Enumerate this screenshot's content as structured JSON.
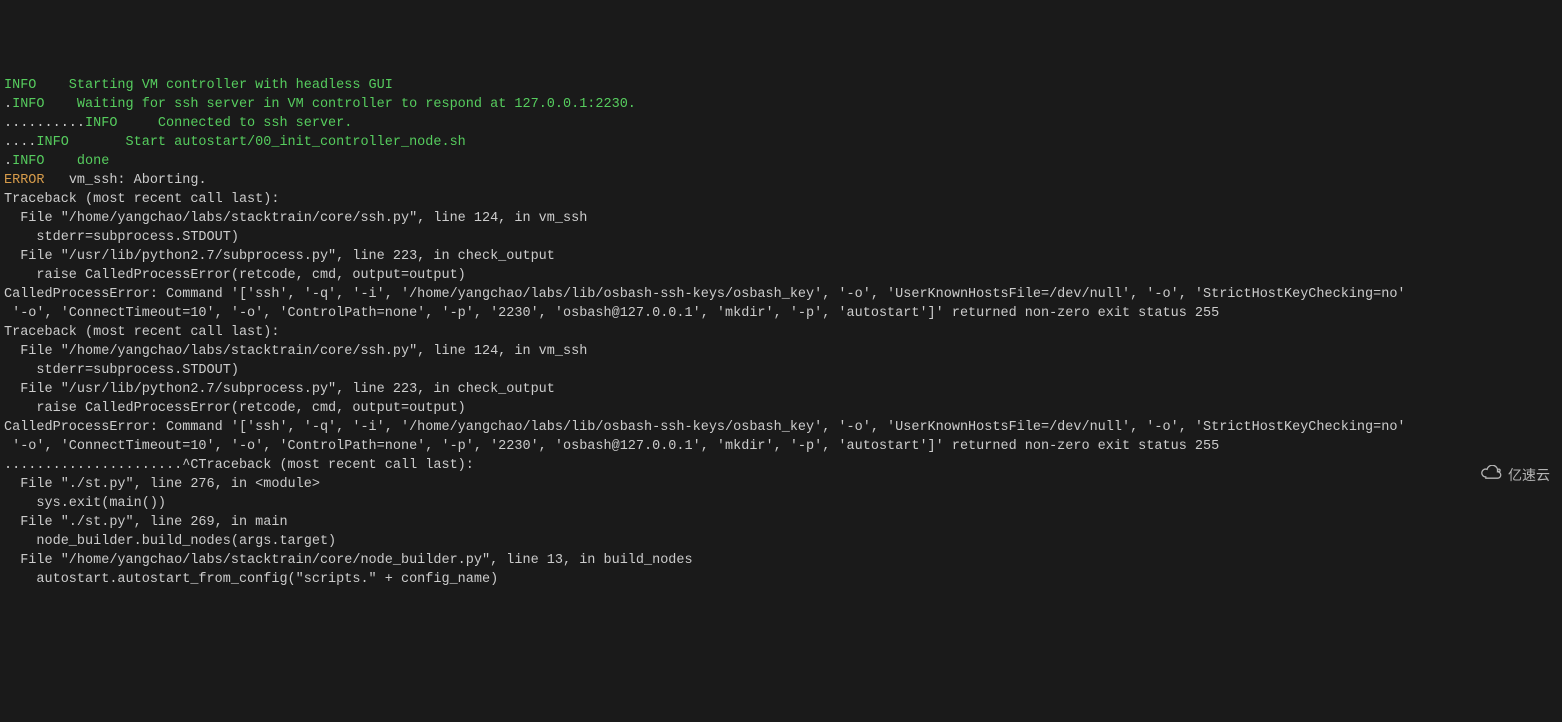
{
  "lines": [
    {
      "segments": [
        {
          "cls": "green",
          "text": "INFO"
        },
        {
          "cls": "green",
          "text": "    Starting VM controller with headless GUI"
        }
      ]
    },
    {
      "segments": [
        {
          "cls": "gray",
          "text": "."
        },
        {
          "cls": "green",
          "text": "INFO"
        },
        {
          "cls": "green",
          "text": "    Waiting for ssh server in VM controller to respond at 127.0.0.1:2230."
        }
      ]
    },
    {
      "segments": [
        {
          "cls": "gray",
          "text": ".........."
        },
        {
          "cls": "green",
          "text": "INFO"
        },
        {
          "cls": "green",
          "text": "     Connected to ssh server."
        }
      ]
    },
    {
      "segments": [
        {
          "cls": "gray",
          "text": "...."
        },
        {
          "cls": "green",
          "text": "INFO"
        },
        {
          "cls": "green",
          "text": "       Start autostart/00_init_controller_node.sh"
        }
      ]
    },
    {
      "segments": [
        {
          "cls": "gray",
          "text": "."
        },
        {
          "cls": "green",
          "text": "INFO"
        },
        {
          "cls": "green",
          "text": "    done"
        }
      ]
    },
    {
      "segments": [
        {
          "cls": "orange",
          "text": "ERROR"
        },
        {
          "cls": "gray",
          "text": "   vm_ssh: Aborting."
        }
      ]
    },
    {
      "segments": [
        {
          "cls": "gray",
          "text": "Traceback (most recent call last):"
        }
      ]
    },
    {
      "segments": [
        {
          "cls": "gray",
          "text": "  File \"/home/yangchao/labs/stacktrain/core/ssh.py\", line 124, in vm_ssh"
        }
      ]
    },
    {
      "segments": [
        {
          "cls": "gray",
          "text": "    stderr=subprocess.STDOUT)"
        }
      ]
    },
    {
      "segments": [
        {
          "cls": "gray",
          "text": "  File \"/usr/lib/python2.7/subprocess.py\", line 223, in check_output"
        }
      ]
    },
    {
      "segments": [
        {
          "cls": "gray",
          "text": "    raise CalledProcessError(retcode, cmd, output=output)"
        }
      ]
    },
    {
      "segments": [
        {
          "cls": "gray",
          "text": "CalledProcessError: Command '['ssh', '-q', '-i', '/home/yangchao/labs/lib/osbash-ssh-keys/osbash_key', '-o', 'UserKnownHostsFile=/dev/null', '-o', 'StrictHostKeyChecking=no'"
        }
      ]
    },
    {
      "segments": [
        {
          "cls": "gray",
          "text": " '-o', 'ConnectTimeout=10', '-o', 'ControlPath=none', '-p', '2230', 'osbash@127.0.0.1', 'mkdir', '-p', 'autostart']' returned non-zero exit status 255"
        }
      ]
    },
    {
      "segments": [
        {
          "cls": "gray",
          "text": "Traceback (most recent call last):"
        }
      ]
    },
    {
      "segments": [
        {
          "cls": "gray",
          "text": "  File \"/home/yangchao/labs/stacktrain/core/ssh.py\", line 124, in vm_ssh"
        }
      ]
    },
    {
      "segments": [
        {
          "cls": "gray",
          "text": "    stderr=subprocess.STDOUT)"
        }
      ]
    },
    {
      "segments": [
        {
          "cls": "gray",
          "text": "  File \"/usr/lib/python2.7/subprocess.py\", line 223, in check_output"
        }
      ]
    },
    {
      "segments": [
        {
          "cls": "gray",
          "text": "    raise CalledProcessError(retcode, cmd, output=output)"
        }
      ]
    },
    {
      "segments": [
        {
          "cls": "gray",
          "text": "CalledProcessError: Command '['ssh', '-q', '-i', '/home/yangchao/labs/lib/osbash-ssh-keys/osbash_key', '-o', 'UserKnownHostsFile=/dev/null', '-o', 'StrictHostKeyChecking=no'"
        }
      ]
    },
    {
      "segments": [
        {
          "cls": "gray",
          "text": " '-o', 'ConnectTimeout=10', '-o', 'ControlPath=none', '-p', '2230', 'osbash@127.0.0.1', 'mkdir', '-p', 'autostart']' returned non-zero exit status 255"
        }
      ]
    },
    {
      "segments": [
        {
          "cls": "gray",
          "text": "......................^CTraceback (most recent call last):"
        }
      ]
    },
    {
      "segments": [
        {
          "cls": "gray",
          "text": "  File \"./st.py\", line 276, in <module>"
        }
      ]
    },
    {
      "segments": [
        {
          "cls": "gray",
          "text": "    sys.exit(main())"
        }
      ]
    },
    {
      "segments": [
        {
          "cls": "gray",
          "text": "  File \"./st.py\", line 269, in main"
        }
      ]
    },
    {
      "segments": [
        {
          "cls": "gray",
          "text": "    node_builder.build_nodes(args.target)"
        }
      ]
    },
    {
      "segments": [
        {
          "cls": "gray",
          "text": "  File \"/home/yangchao/labs/stacktrain/core/node_builder.py\", line 13, in build_nodes"
        }
      ]
    },
    {
      "segments": [
        {
          "cls": "gray",
          "text": "    autostart.autostart_from_config(\"scripts.\" + config_name)"
        }
      ]
    }
  ],
  "watermark": {
    "text": "亿速云"
  }
}
